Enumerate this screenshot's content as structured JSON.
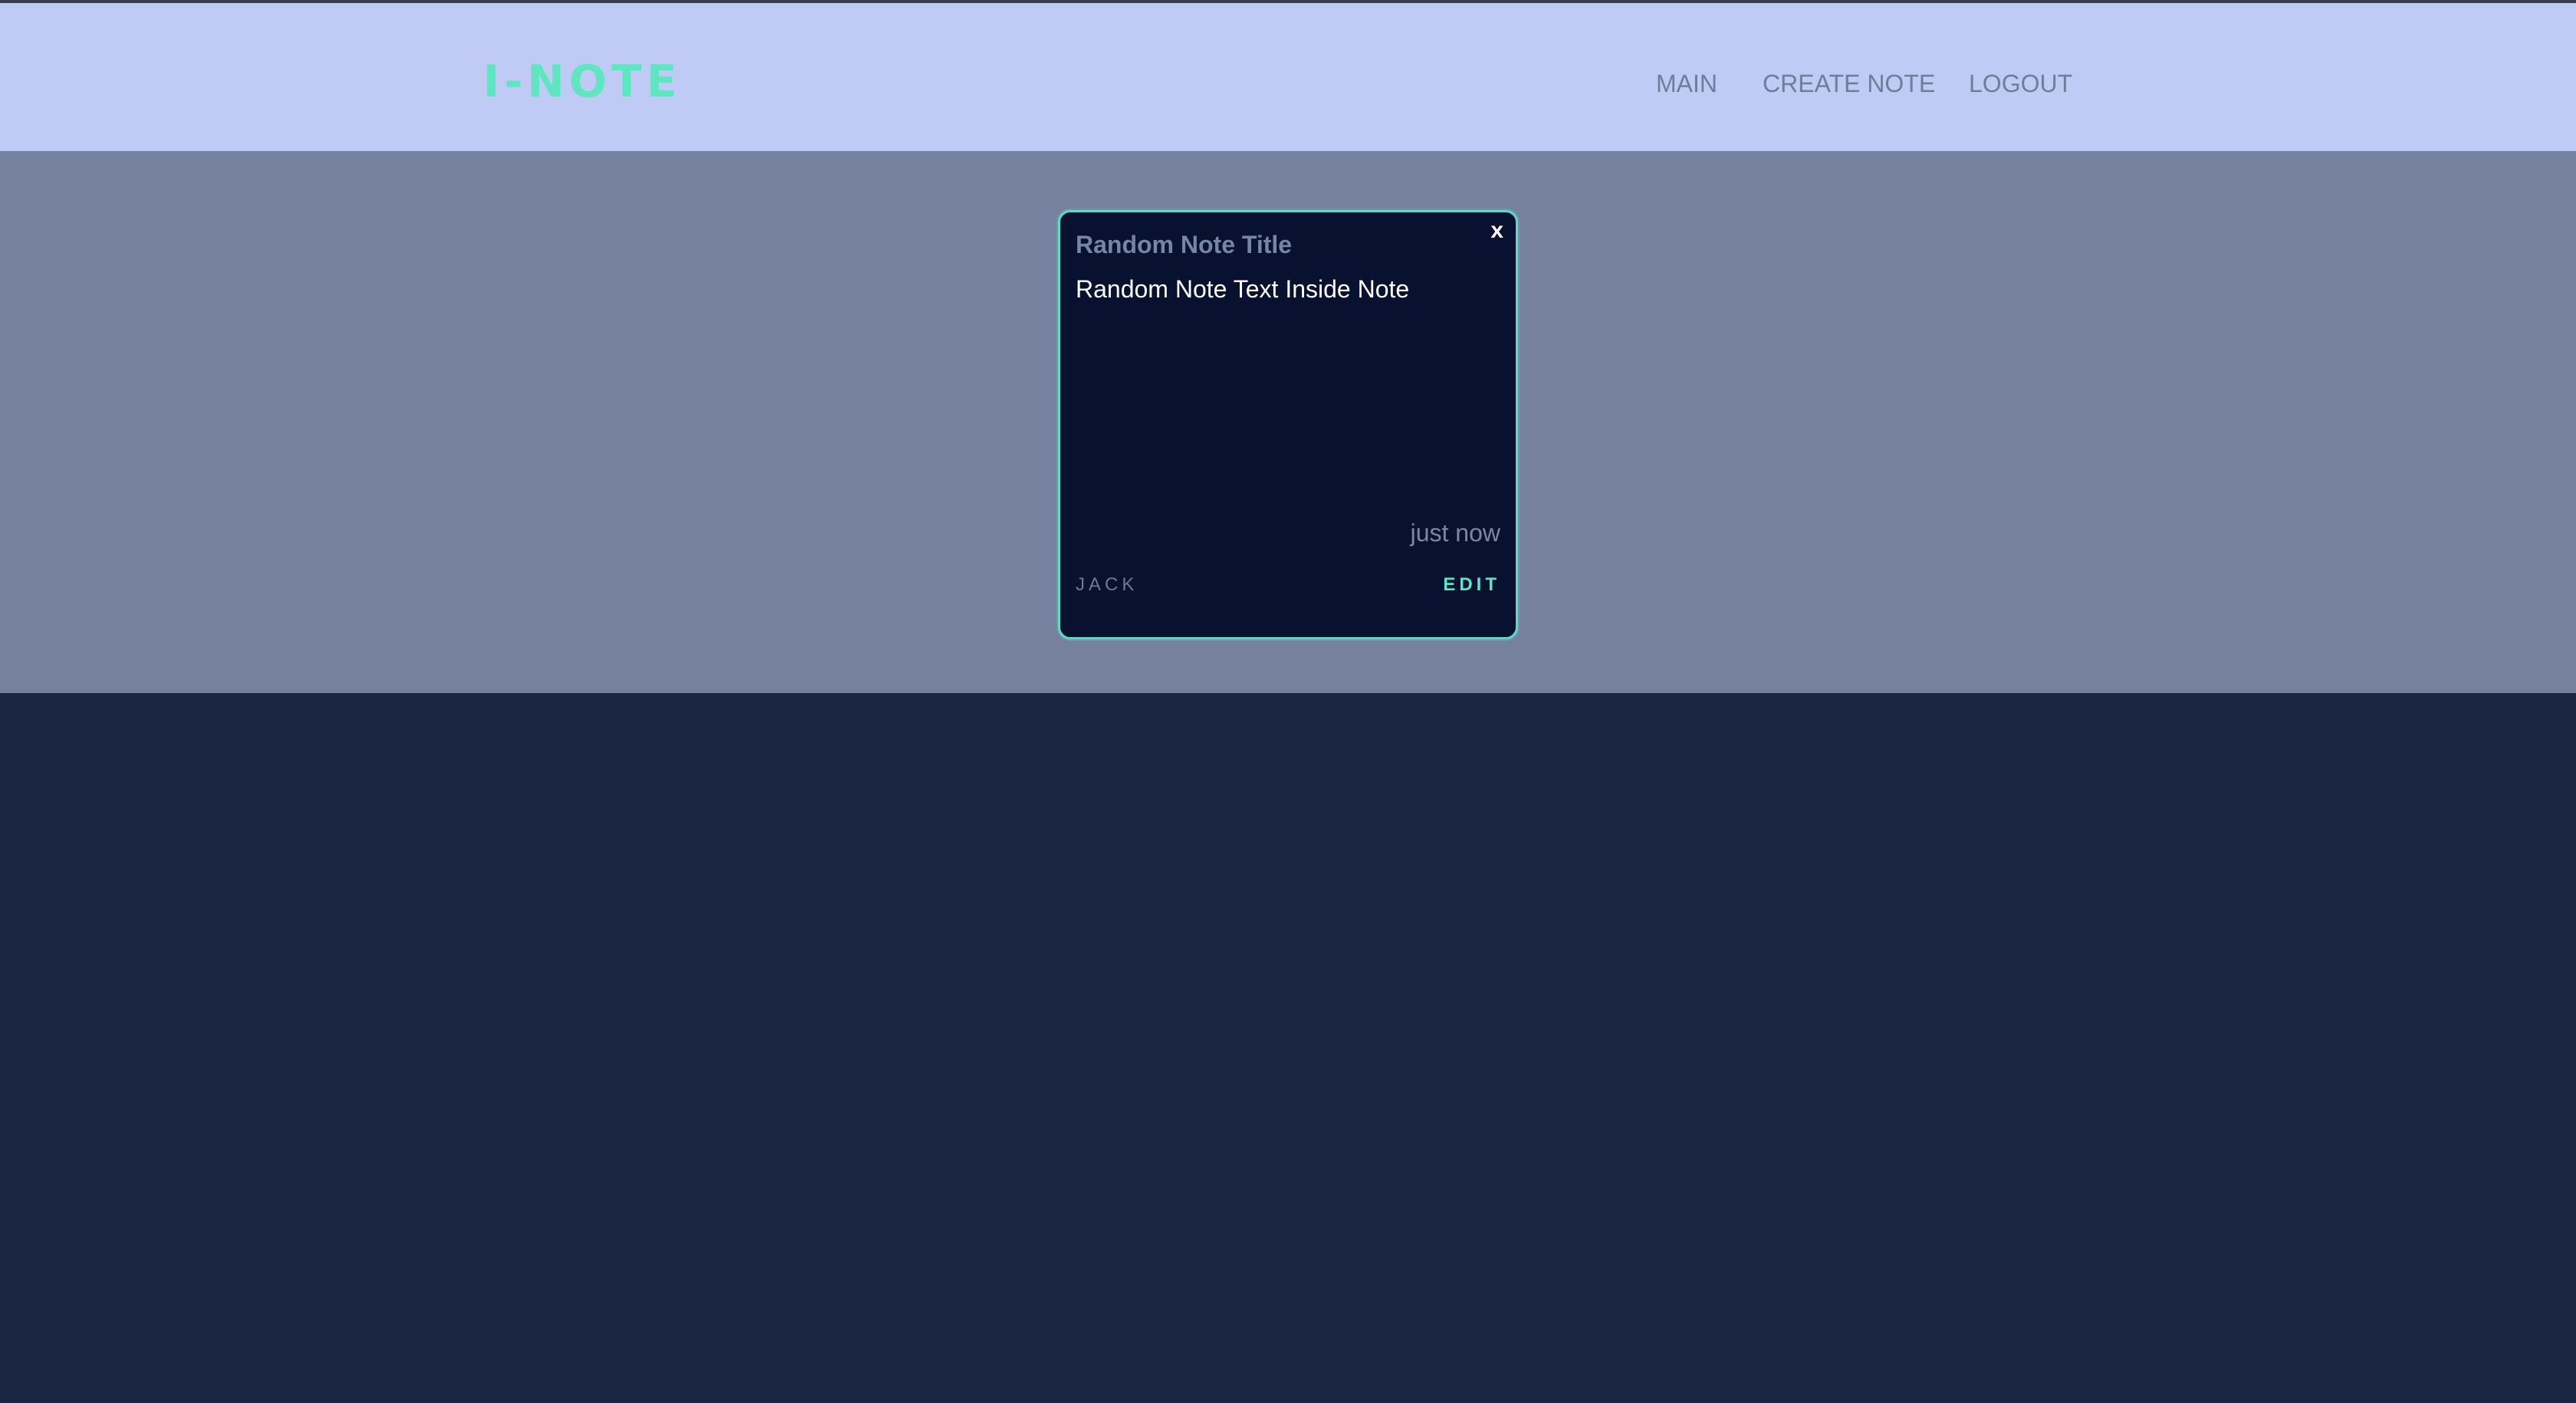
{
  "header": {
    "brand": "I-NOTE",
    "nav": {
      "main": "MAIN",
      "create_note": "CREATE NOTE",
      "logout": "LOGOUT"
    }
  },
  "note": {
    "close_label": "x",
    "title": "Random Note Title",
    "text": "Random Note Text Inside Note",
    "timestamp": "just now",
    "author": "JACK",
    "edit_label": "EDIT"
  },
  "colors": {
    "header_bg": "#c0cbf5",
    "accent": "#5ee6c0",
    "overlay_band": "#76819f",
    "page_bg": "#1a2642",
    "card_bg": "#081230",
    "card_border": "#5fd9c6"
  }
}
